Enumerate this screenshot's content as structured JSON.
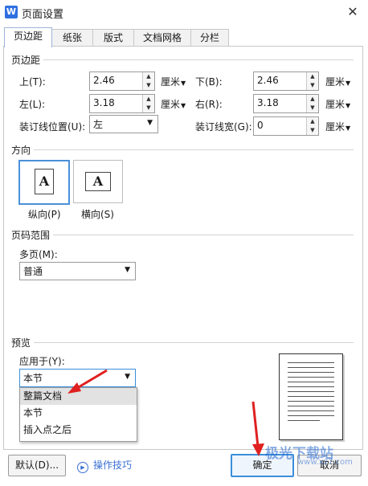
{
  "window": {
    "title": "页面设置",
    "app_icon": "W",
    "close_glyph": "✕"
  },
  "tabs": [
    "页边距",
    "纸张",
    "版式",
    "文档网格",
    "分栏"
  ],
  "margins": {
    "section_title": "页边距",
    "top": {
      "label": "上(T):",
      "value": "2.46",
      "unit": "厘米"
    },
    "bottom": {
      "label": "下(B):",
      "value": "2.46",
      "unit": "厘米"
    },
    "left": {
      "label": "左(L):",
      "value": "3.18",
      "unit": "厘米"
    },
    "right": {
      "label": "右(R):",
      "value": "3.18",
      "unit": "厘米"
    },
    "gutter_pos": {
      "label": "装订线位置(U):",
      "value": "左"
    },
    "gutter": {
      "label": "装订线宽(G):",
      "value": "0",
      "unit": "厘米"
    }
  },
  "orientation": {
    "section_title": "方向",
    "portrait": {
      "label": "纵向(P)",
      "glyph": "A"
    },
    "landscape": {
      "label": "横向(S)",
      "glyph": "A"
    },
    "selected": "portrait"
  },
  "pages": {
    "section_title": "页码范围",
    "multiple_label": "多页(M):",
    "multiple_value": "普通"
  },
  "preview": {
    "section_title": "预览",
    "apply_label": "应用于(Y):",
    "apply_value": "本节",
    "options": [
      "整篇文档",
      "本节",
      "插入点之后"
    ],
    "highlighted_index": 0
  },
  "buttons": {
    "default": "默认(D)...",
    "tips": "操作技巧",
    "ok": "确定",
    "cancel": "取消"
  },
  "watermark": {
    "text": "极光下载站",
    "sub": "www.xz7.com"
  },
  "colors": {
    "accent": "#4a90d9",
    "annotation_arrow": "#e02020",
    "link": "#3b6fd4"
  }
}
